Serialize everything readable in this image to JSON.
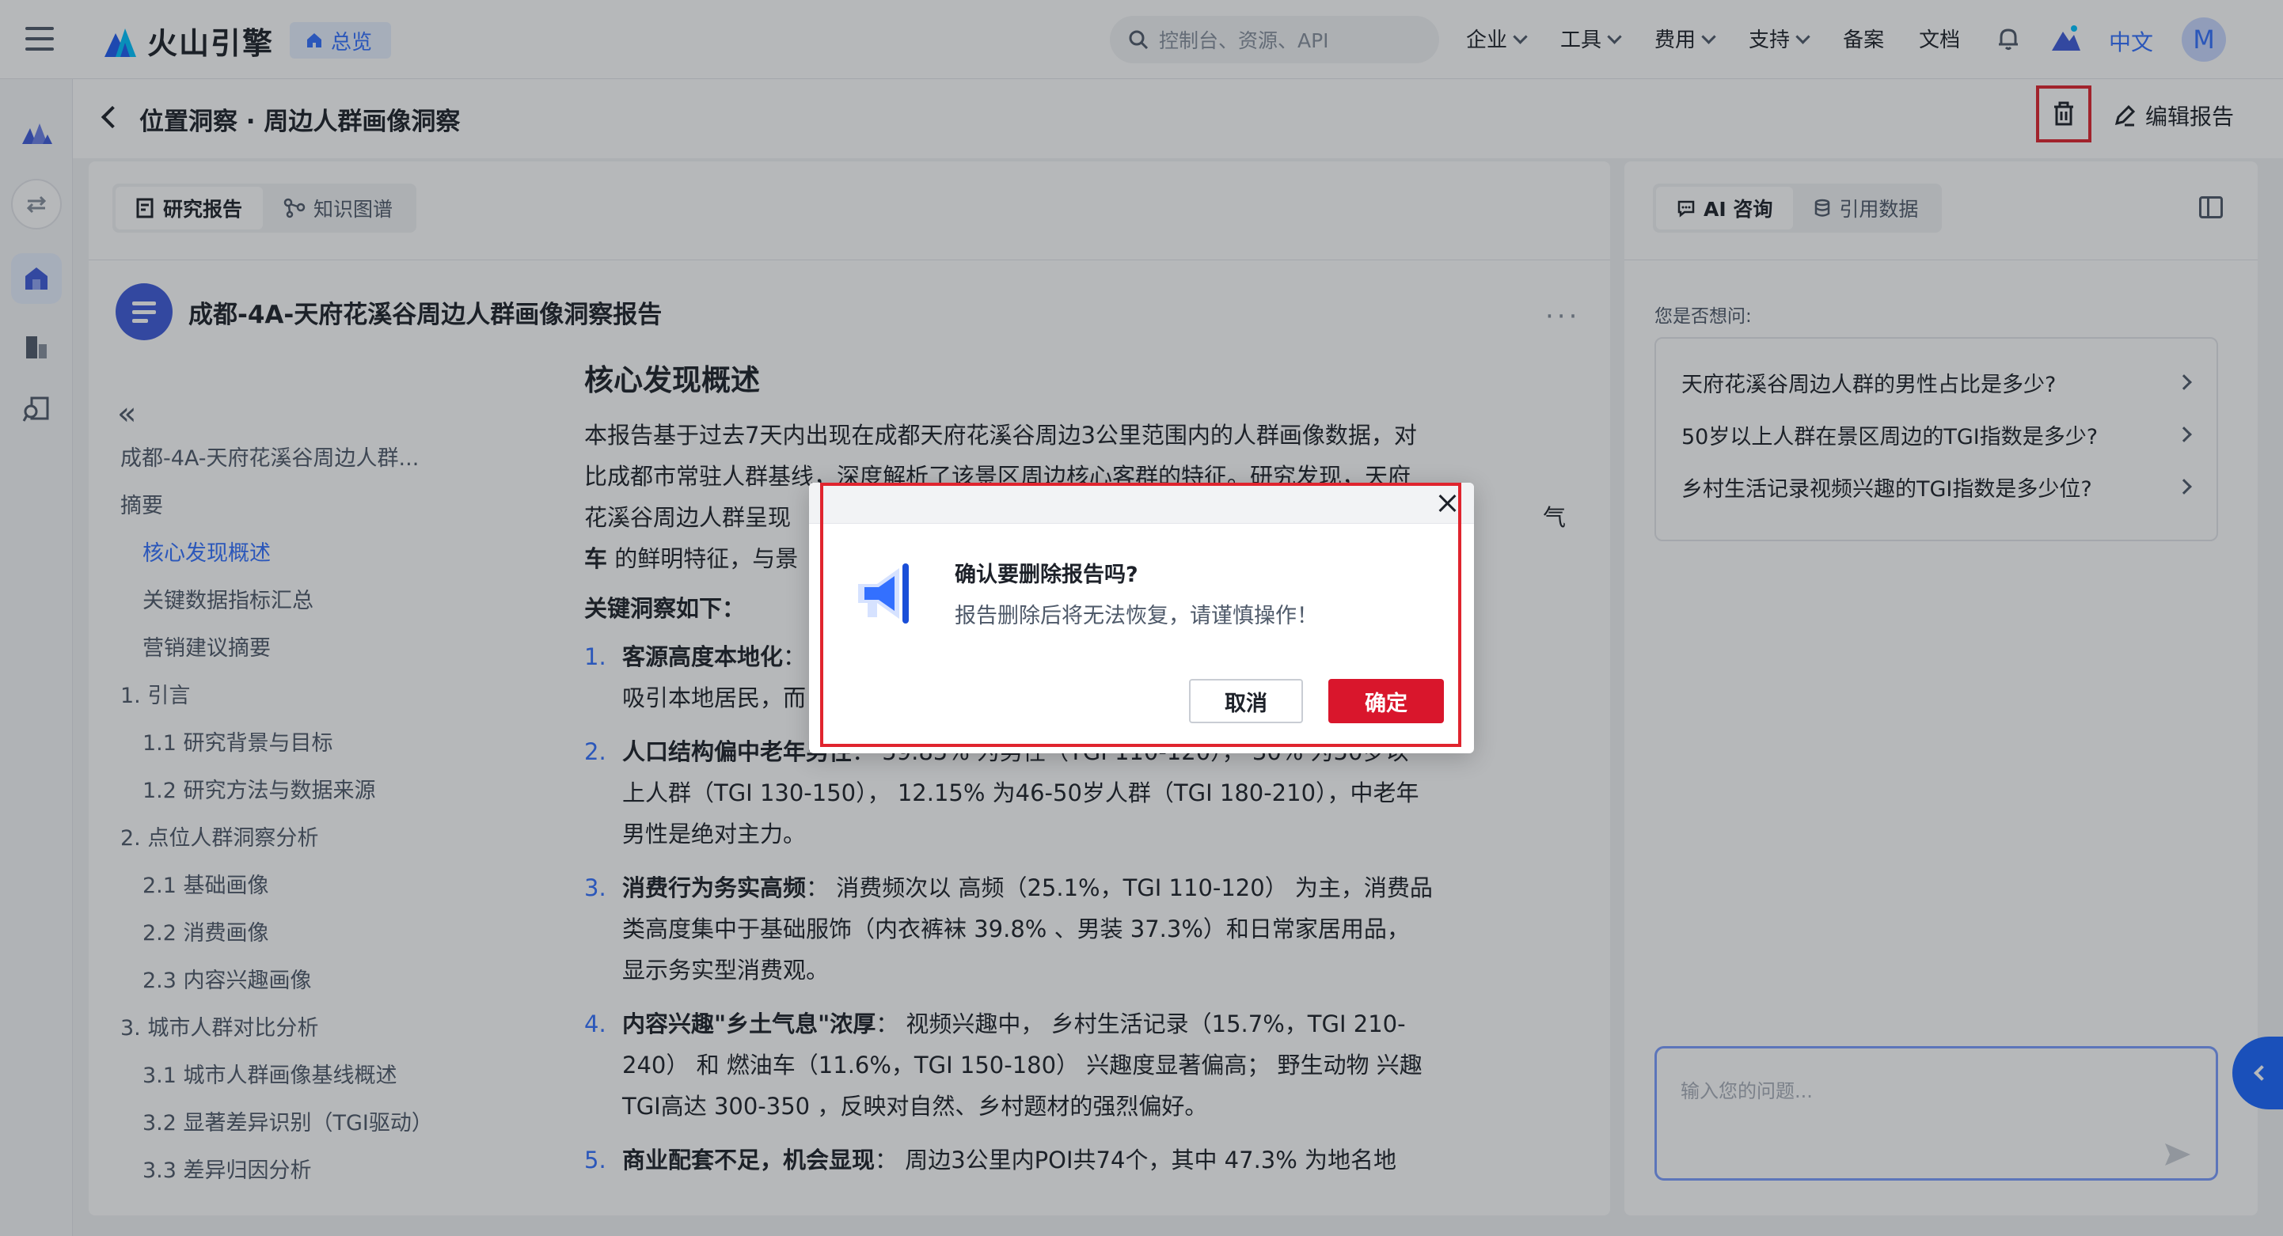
{
  "app": {
    "name": "火山引擎",
    "overview": "总览"
  },
  "search": {
    "placeholder": "控制台、资源、API"
  },
  "nav": [
    "企业",
    "工具",
    "费用",
    "支持",
    "备案",
    "文档"
  ],
  "lang": "中文",
  "avatar": "M",
  "page": {
    "title": "位置洞察 · 周边人群画像洞察",
    "edit_label": "编辑报告"
  },
  "report_tabs": [
    "研究报告",
    "知识图谱"
  ],
  "report": {
    "title": "成都-4A-天府花溪谷周边人群画像洞察报告"
  },
  "toc": [
    {
      "label": "成都-4A-天府花溪谷周边人群...",
      "level": 1
    },
    {
      "label": "摘要",
      "level": 1
    },
    {
      "label": "核心发现概述",
      "level": 2,
      "active": true
    },
    {
      "label": "关键数据指标汇总",
      "level": 2
    },
    {
      "label": "营销建议摘要",
      "level": 2
    },
    {
      "label": "1. 引言",
      "level": 1
    },
    {
      "label": "1.1 研究背景与目标",
      "level": 2
    },
    {
      "label": "1.2 研究方法与数据来源",
      "level": 2
    },
    {
      "label": "2. 点位人群洞察分析",
      "level": 1
    },
    {
      "label": "2.1 基础画像",
      "level": 2
    },
    {
      "label": "2.2 消费画像",
      "level": 2
    },
    {
      "label": "2.3 内容兴趣画像",
      "level": 2
    },
    {
      "label": "3. 城市人群对比分析",
      "level": 1
    },
    {
      "label": "3.1 城市人群画像基线概述",
      "level": 2
    },
    {
      "label": "3.2 显著差异识别（TGI驱动）",
      "level": 2
    },
    {
      "label": "3.3 差异归因分析",
      "level": 2
    }
  ],
  "content": {
    "heading": "核心发现概述",
    "intro_1": "本报告基于过去7天内出现在成都天府花溪谷周边3公里范围内的人群画像数据，对",
    "intro_2": "比成都市常驻人群基线，深度解析了该景区周边核心客群的特征。研究发现，天府",
    "intro_3": "花溪谷周边人群呈现",
    "intro_4_bold": "车",
    "intro_4": " 的鲜明特征，与景",
    "intro_3_right": "气",
    "insights_label": "关键洞察如下：",
    "insights": [
      {
        "num": "1.",
        "lines": [
          {
            "b": "客源高度本地化",
            "t": "："
          },
          {
            "b": "",
            "t": "吸引本地居民，而"
          }
        ]
      },
      {
        "num": "2.",
        "lines": [
          {
            "b": "人口结构偏中老年男性",
            "t": "： 59.85% 为男性（TGI 110-120）， 30% 为50岁以"
          },
          {
            "b": "",
            "t": "上人群（TGI 130-150）， 12.15% 为46-50岁人群（TGI 180-210），中老年"
          },
          {
            "b": "",
            "t": "男性是绝对主力。"
          }
        ]
      },
      {
        "num": "3.",
        "lines": [
          {
            "b": "消费行为务实高频",
            "t": "： 消费频次以 高频（25.1%，TGI 110-120） 为主，消费品"
          },
          {
            "b": "",
            "t": "类高度集中于基础服饰（内衣裤袜 39.8% 、男装 37.3%）和日常家居用品，"
          },
          {
            "b": "",
            "t": "显示务实型消费观。"
          }
        ]
      },
      {
        "num": "4.",
        "lines": [
          {
            "b": "内容兴趣\"乡土气息\"浓厚",
            "t": "： 视频兴趣中， 乡村生活记录（15.7%，TGI 210-"
          },
          {
            "b": "",
            "t": "240） 和 燃油车（11.6%，TGI 150-180） 兴趣度显著偏高； 野生动物 兴趣"
          },
          {
            "b": "",
            "t": "TGI高达 300-350 ，反映对自然、乡村题材的强烈偏好。"
          }
        ]
      },
      {
        "num": "5.",
        "lines": [
          {
            "b": "商业配套不足，机会显现",
            "t": "： 周边3公里内POI共74个，其中 47.3% 为地名地"
          }
        ]
      }
    ]
  },
  "ai_tabs": [
    "AI 咨询",
    "引用数据"
  ],
  "ai": {
    "suggest_label": "您是否想问:",
    "questions": [
      "天府花溪谷周边人群的男性占比是多少?",
      "50岁以上人群在景区周边的TGI指数是多少?",
      "乡村生活记录视频兴趣的TGI指数是多少位?"
    ],
    "input_placeholder": "输入您的问题..."
  },
  "dialog": {
    "title": "确认要删除报告吗?",
    "message": "报告删除后将无法恢复，请谨慎操作！",
    "cancel": "取消",
    "confirm": "确定"
  },
  "colors": {
    "accent": "#3370ff",
    "danger": "#d9162c",
    "highlight": "#e0242e"
  }
}
